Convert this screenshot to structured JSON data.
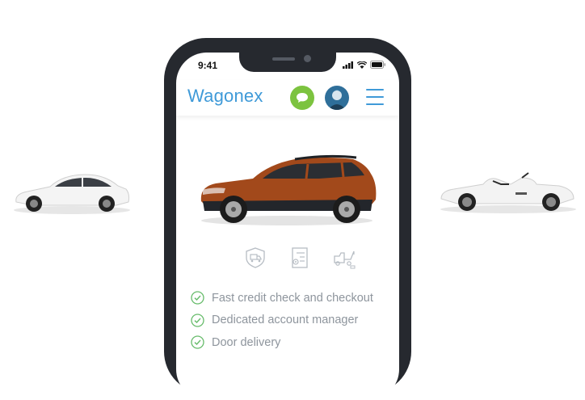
{
  "status_bar": {
    "time": "9:41"
  },
  "header": {
    "logo": "Wagonex",
    "chat_icon": "chat-bubble-icon",
    "menu_icon": "hamburger-menu-icon"
  },
  "hero": {
    "image": "orange-suv-photo"
  },
  "feature_icons": [
    "truck-shield-icon",
    "document-gear-icon",
    "tow-truck-icon"
  ],
  "features": [
    {
      "icon": "check-circle-icon",
      "text": "Fast credit check and checkout"
    },
    {
      "icon": "check-circle-icon",
      "text": "Dedicated account manager"
    },
    {
      "icon": "check-circle-icon",
      "text": "Door delivery"
    }
  ],
  "side_cars": [
    "white-sedan-photo",
    "white-convertible-photo"
  ],
  "colors": {
    "brand": "#3f9ad8",
    "chat": "#7cc33f",
    "check": "#66bb6a",
    "phone_frame": "#26292f",
    "car_body": "#a2491b"
  }
}
